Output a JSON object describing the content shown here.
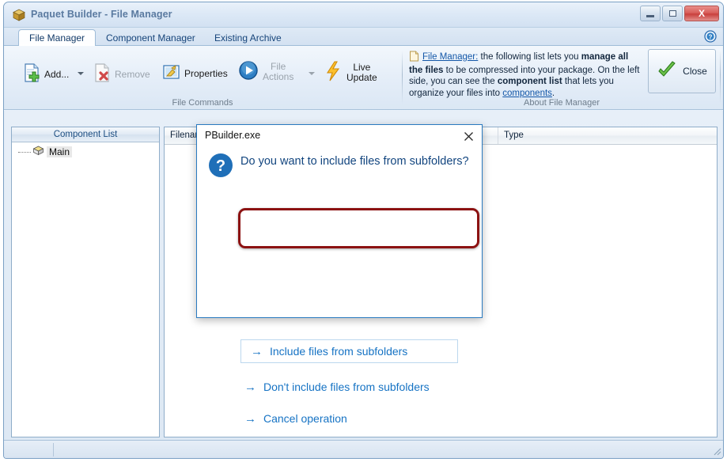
{
  "window": {
    "title": "Paquet Builder - File Manager",
    "app_icon": "package-box-icon",
    "minimize_label": "",
    "maximize_label": "",
    "close_label": "X"
  },
  "tabs": [
    {
      "label": "File Manager",
      "active": true
    },
    {
      "label": "Component Manager",
      "active": false
    },
    {
      "label": "Existing Archive",
      "active": false
    }
  ],
  "help_icon": "help-question-icon",
  "ribbon": {
    "groups": [
      {
        "caption": "File Commands"
      },
      {
        "caption": "About File Manager"
      }
    ],
    "buttons": [
      {
        "label": "Add...",
        "icon": "add-file-icon",
        "disabled": false,
        "has_dropdown": true
      },
      {
        "label": "Remove",
        "icon": "remove-file-icon",
        "disabled": true,
        "has_dropdown": false
      },
      {
        "label": "Properties",
        "icon": "properties-icon",
        "disabled": false,
        "has_dropdown": false
      },
      {
        "label_line1": "File",
        "label_line2": "Actions",
        "icon": "play-circle-icon",
        "disabled": true,
        "has_dropdown": true
      },
      {
        "label_line1": "Live",
        "label_line2": "Update",
        "icon": "lightning-bolt-icon",
        "disabled": false,
        "has_dropdown": false
      }
    ],
    "info": {
      "icon": "document-icon",
      "link_title": "File Manager:",
      "text_1": " the following list lets you ",
      "bold_1": "manage all the files",
      "text_2": " to be compressed into your package. On the left side, you can see the ",
      "bold_2": "component list",
      "text_3": " that lets you organize your files into ",
      "link_2": "components",
      "text_4": ".",
      "close_button": "Close",
      "close_icon": "green-check-icon"
    }
  },
  "panes": {
    "component_list": {
      "header": "Component List",
      "items": [
        {
          "label": "Main",
          "icon": "package-icon",
          "selected": true
        }
      ]
    },
    "file_list": {
      "columns": [
        "Filename",
        "Type"
      ]
    }
  },
  "dialog": {
    "title": "PBuilder.exe",
    "close_icon": "close-x-icon",
    "question_icon": "question-circle-icon",
    "message": "Do you want to include files from subfolders?",
    "links": [
      {
        "label": "Include files from subfolders",
        "highlighted": true
      },
      {
        "label": "Don't include files from subfolders",
        "highlighted": false
      },
      {
        "label": "Cancel operation",
        "highlighted": false
      }
    ]
  },
  "statusbar": {
    "text": ""
  },
  "colors": {
    "accent_blue": "#1673c4",
    "dialog_border": "#2a7ac0",
    "highlight_red": "#8c1212",
    "title_text": "#5a7aa0",
    "link_blue": "#1357a8"
  }
}
